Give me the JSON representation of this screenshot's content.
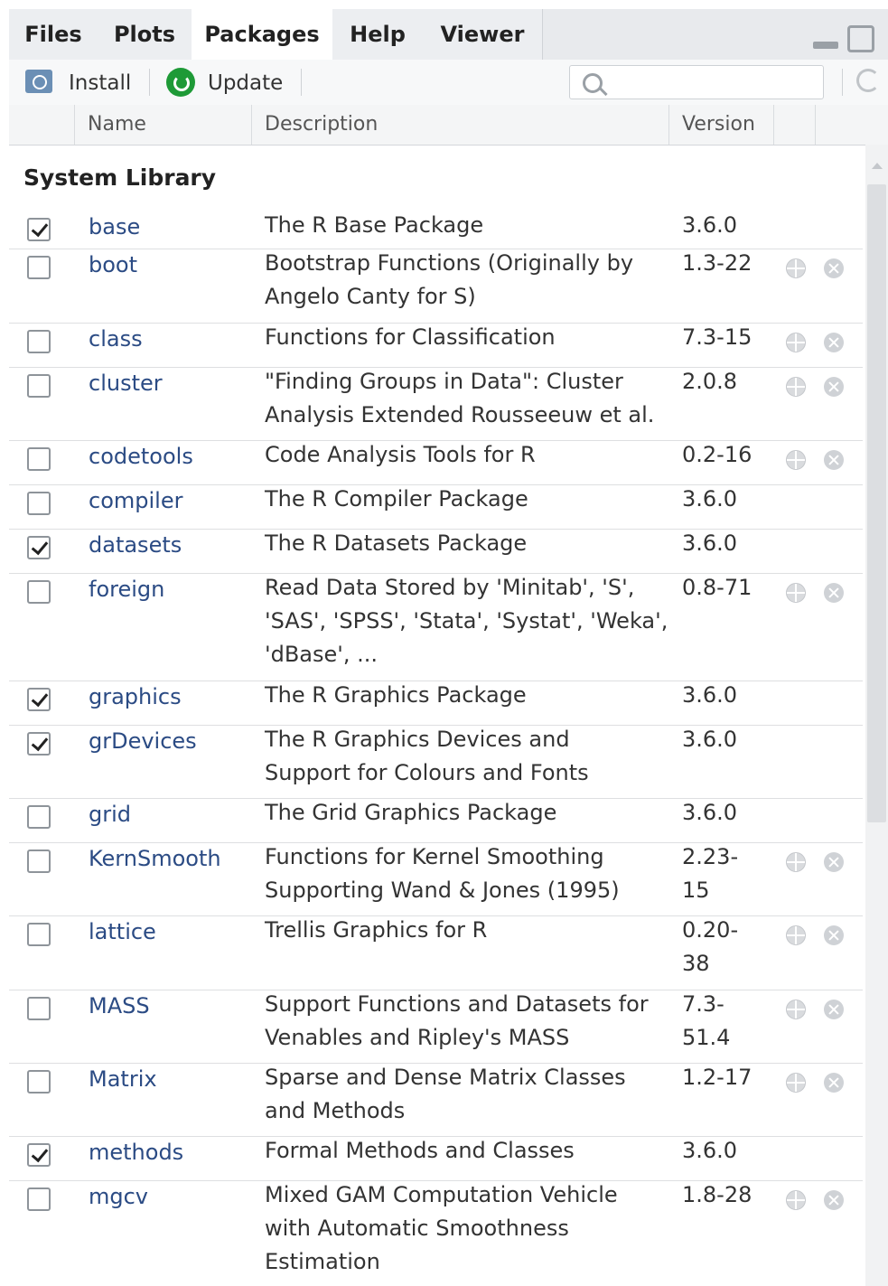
{
  "tabs": [
    "Files",
    "Plots",
    "Packages",
    "Help",
    "Viewer"
  ],
  "active_tab": "Packages",
  "toolbar": {
    "install_label": "Install",
    "update_label": "Update",
    "search_placeholder": ""
  },
  "columns": {
    "name": "Name",
    "description": "Description",
    "version": "Version"
  },
  "section_title": "System Library",
  "packages": [
    {
      "checked": true,
      "name": "base",
      "desc": [
        "The R Base Package"
      ],
      "ver": [
        "3.6.0"
      ],
      "actions": false
    },
    {
      "checked": false,
      "name": "boot",
      "desc": [
        "Bootstrap Functions (Originally by",
        "Angelo Canty for S)"
      ],
      "ver": [
        "1.3-22"
      ],
      "actions": true
    },
    {
      "checked": false,
      "name": "class",
      "desc": [
        "Functions for Classification"
      ],
      "ver": [
        "7.3-15"
      ],
      "actions": true
    },
    {
      "checked": false,
      "name": "cluster",
      "desc": [
        "\"Finding Groups in Data\": Cluster",
        "Analysis Extended Rousseeuw et al."
      ],
      "ver": [
        "2.0.8"
      ],
      "actions": true
    },
    {
      "checked": false,
      "name": "codetools",
      "desc": [
        "Code Analysis Tools for R"
      ],
      "ver": [
        "0.2-16"
      ],
      "actions": true
    },
    {
      "checked": false,
      "name": "compiler",
      "desc": [
        "The R Compiler Package"
      ],
      "ver": [
        "3.6.0"
      ],
      "actions": false
    },
    {
      "checked": true,
      "name": "datasets",
      "desc": [
        "The R Datasets Package"
      ],
      "ver": [
        "3.6.0"
      ],
      "actions": false
    },
    {
      "checked": false,
      "name": "foreign",
      "desc": [
        "Read Data Stored by 'Minitab', 'S',",
        "'SAS', 'SPSS', 'Stata', 'Systat', 'Weka',",
        "'dBase', ..."
      ],
      "ver": [
        "0.8-71"
      ],
      "actions": true
    },
    {
      "checked": true,
      "name": "graphics",
      "desc": [
        "The R Graphics Package"
      ],
      "ver": [
        "3.6.0"
      ],
      "actions": false
    },
    {
      "checked": true,
      "name": "grDevices",
      "desc": [
        "The R Graphics Devices and",
        "Support for Colours and Fonts"
      ],
      "ver": [
        "3.6.0"
      ],
      "actions": false
    },
    {
      "checked": false,
      "name": "grid",
      "desc": [
        "The Grid Graphics Package"
      ],
      "ver": [
        "3.6.0"
      ],
      "actions": false
    },
    {
      "checked": false,
      "name": "KernSmooth",
      "desc": [
        "Functions for Kernel Smoothing",
        "Supporting Wand & Jones (1995)"
      ],
      "ver": [
        "2.23-",
        "15"
      ],
      "actions": true
    },
    {
      "checked": false,
      "name": "lattice",
      "desc": [
        "Trellis Graphics for R"
      ],
      "ver": [
        "0.20-",
        "38"
      ],
      "actions": true
    },
    {
      "checked": false,
      "name": "MASS",
      "desc": [
        "Support Functions and Datasets for",
        "Venables and Ripley's MASS"
      ],
      "ver": [
        "7.3-",
        "51.4"
      ],
      "actions": true
    },
    {
      "checked": false,
      "name": "Matrix",
      "desc": [
        "Sparse and Dense Matrix Classes",
        "and Methods"
      ],
      "ver": [
        "1.2-17"
      ],
      "actions": true
    },
    {
      "checked": true,
      "name": "methods",
      "desc": [
        "Formal Methods and Classes"
      ],
      "ver": [
        "3.6.0"
      ],
      "actions": false
    },
    {
      "checked": false,
      "name": "mgcv",
      "desc": [
        "Mixed GAM Computation Vehicle",
        "with Automatic Smoothness",
        "Estimation"
      ],
      "ver": [
        "1.8-28"
      ],
      "actions": true
    }
  ]
}
